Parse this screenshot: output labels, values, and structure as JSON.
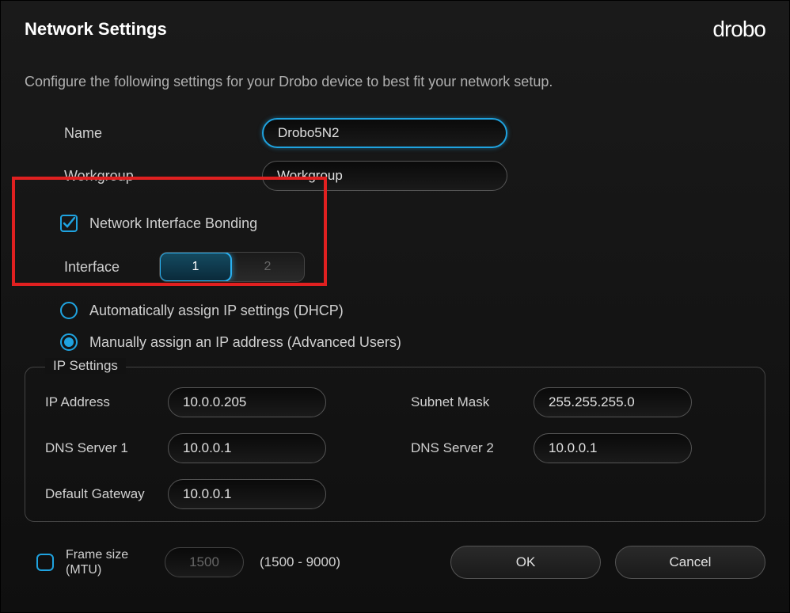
{
  "header": {
    "title": "Network Settings",
    "logo": "drobo"
  },
  "description": "Configure the following settings for your Drobo device to best fit your network setup.",
  "basic": {
    "name_label": "Name",
    "name_value": "Drobo5N2",
    "workgroup_label": "Workgroup",
    "workgroup_value": "Workgroup"
  },
  "bonding": {
    "label": "Network Interface Bonding",
    "checked": true,
    "interface_label": "Interface",
    "interface_options": [
      "1",
      "2"
    ],
    "interface_selected": "1"
  },
  "ip_mode": {
    "dhcp_label": "Automatically assign IP settings (DHCP)",
    "manual_label": "Manually assign an IP address (Advanced Users)",
    "selected": "manual"
  },
  "ip_settings": {
    "legend": "IP Settings",
    "ip_address_label": "IP Address",
    "ip_address_value": "10.0.0.205",
    "subnet_mask_label": "Subnet Mask",
    "subnet_mask_value": "255.255.255.0",
    "dns1_label": "DNS Server 1",
    "dns1_value": "10.0.0.1",
    "dns2_label": "DNS Server 2",
    "dns2_value": "10.0.0.1",
    "gateway_label": "Default Gateway",
    "gateway_value": "10.0.0.1"
  },
  "mtu": {
    "checked": false,
    "label_line1": "Frame size",
    "label_line2": "(MTU)",
    "value": "1500",
    "range": "(1500 - 9000)"
  },
  "buttons": {
    "ok": "OK",
    "cancel": "Cancel"
  }
}
